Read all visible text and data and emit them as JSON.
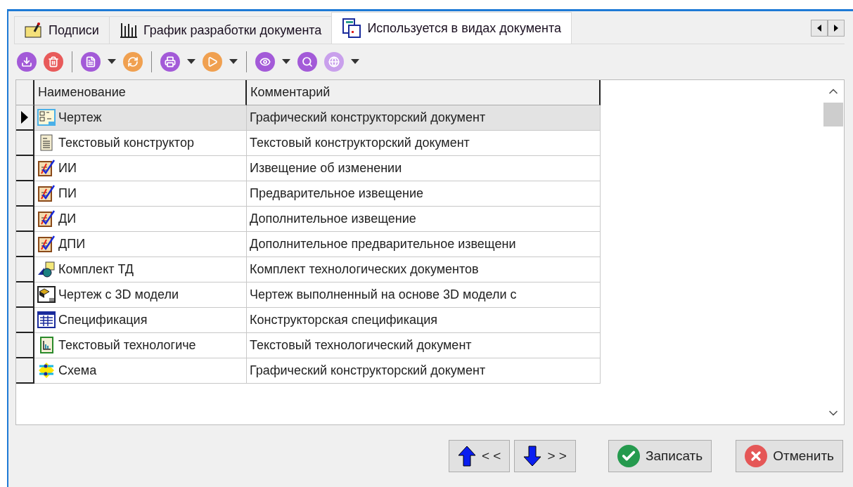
{
  "tabs": [
    {
      "label": "Подписи",
      "kind": "signature",
      "selected": false
    },
    {
      "label": "График разработки документа",
      "kind": "chart",
      "selected": false
    },
    {
      "label": "Используется в видах документа",
      "kind": "usage",
      "selected": true
    }
  ],
  "table": {
    "columns": [
      "Наименование",
      "Комментарий"
    ],
    "rows": [
      {
        "kind": "drawing",
        "name": "Чертеж",
        "comment": "Графический конструкторский документ",
        "selected": true
      },
      {
        "kind": "text",
        "name": "Текстовый конструктор",
        "comment": "Текстовый конструкторский документ",
        "selected": false
      },
      {
        "kind": "notice",
        "name": "ИИ",
        "comment": "Извещение об изменении",
        "selected": false
      },
      {
        "kind": "notice",
        "name": "ПИ",
        "comment": "Предварительное извещение",
        "selected": false
      },
      {
        "kind": "notice",
        "name": "ДИ",
        "comment": "Дополнительное извещение",
        "selected": false
      },
      {
        "kind": "notice",
        "name": "ДПИ",
        "comment": "Дополнительное предварительное извещени",
        "selected": false
      },
      {
        "kind": "kit",
        "name": "Комплект ТД",
        "comment": "Комплект технологических документов",
        "selected": false
      },
      {
        "kind": "model",
        "name": "Чертеж с 3D модели",
        "comment": "Чертеж выполненный на основе 3D модели с",
        "selected": false
      },
      {
        "kind": "spec",
        "name": "Спецификация",
        "comment": "Конструкторская спецификация",
        "selected": false
      },
      {
        "kind": "tech",
        "name": "Текстовый технологиче",
        "comment": "Текстовый технологический документ",
        "selected": false
      },
      {
        "kind": "scheme",
        "name": "Схема",
        "comment": "Графический конструкторский документ",
        "selected": false
      }
    ]
  },
  "buttons": [
    {
      "kind": "up",
      "label": "< <"
    },
    {
      "kind": "down",
      "label": "> >"
    },
    {
      "kind": "save",
      "label": "Записать"
    },
    {
      "kind": "cancel",
      "label": "Отменить"
    }
  ]
}
